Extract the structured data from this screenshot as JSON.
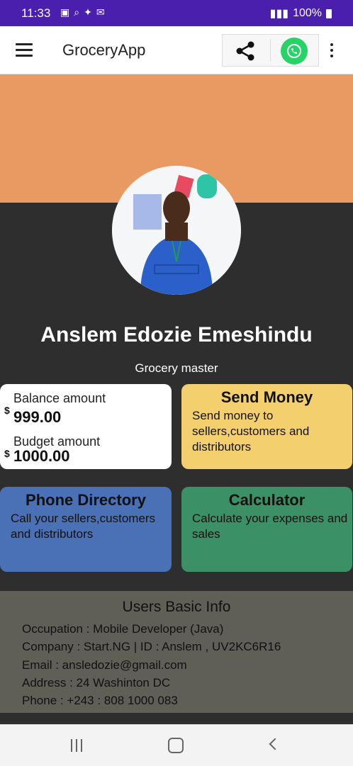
{
  "status_bar": {
    "time": "11:33",
    "battery": "100%"
  },
  "app_bar": {
    "title": "GroceryApp"
  },
  "profile": {
    "name": "Anslem Edozie Emeshindu",
    "role": "Grocery master"
  },
  "balance_card": {
    "balance_label": "Balance amount",
    "balance_currency": "$",
    "balance_value": "999.00",
    "budget_label": "Budget amount",
    "budget_currency": "$",
    "budget_value": "1000.00"
  },
  "send_money_card": {
    "title": "Send Money",
    "body": "Send money to sellers,customers and distributors"
  },
  "phone_directory_card": {
    "title": "Phone Directory",
    "body": "Call your sellers,customers and distributors"
  },
  "calculator_card": {
    "title": "Calculator",
    "body": "Calculate your expenses and sales"
  },
  "user_info": {
    "heading": "Users Basic Info",
    "occupation": "Occupation : Mobile Developer (Java)",
    "company": "Company : Start.NG | ID : Anslem , UV2KC6R16",
    "email": "Email : ansledozie@gmail.com",
    "address": "Address : 24 Washinton DC",
    "phone": "Phone : +243 : 808 1000 083"
  },
  "colors": {
    "status_bar": "#4a1fae",
    "banner": "#e89a62",
    "send_money": "#f3cf6e",
    "phone_directory": "#4a70b6",
    "calculator": "#3c9066"
  }
}
